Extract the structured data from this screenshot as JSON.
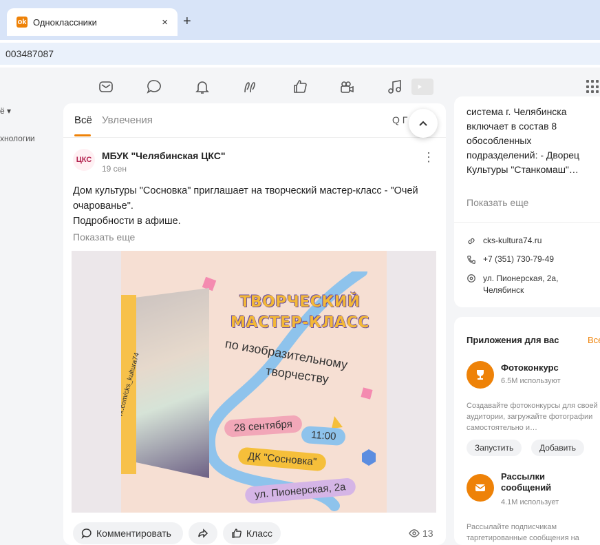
{
  "browser": {
    "tab_title": "Одноклассники",
    "close": "×",
    "new_tab": "+",
    "url": "003487087"
  },
  "left": {
    "item1": "ё ▾",
    "item2": "хнологии"
  },
  "feed": {
    "tab_all": "Всё",
    "tab_hobby": "Увлечения",
    "search": "Q Г"
  },
  "post": {
    "avatar_text": "ЦКС",
    "author": "МБУК \"Челябинская ЦКС\"",
    "date": "19 сен",
    "text_line1": "Дом культуры \"Сосновка\" приглашает на творческий мастер-класс - \"Очей очарованье\".",
    "text_line2": "Подробности в афише.",
    "show_more": "Показать еще",
    "comment": "Комментировать",
    "like": "Класс",
    "views": "13"
  },
  "poster": {
    "side_text": "vk.com/cks_kultura74",
    "title_line1": "ТВОРЧЕСКИЙ",
    "title_line2": "МАСТЕР-КЛАСС",
    "sub1": "по изобразительному",
    "sub2": "творчеству",
    "date": "28 сентября",
    "time": "11:00",
    "place": "ДК \"Сосновка\"",
    "address": "ул. Пионерская, 2а"
  },
  "about": {
    "text": "система г. Челябинска включает в состав 8 обособленных подразделений: - Дворец Культуры \"Станкомаш\"…",
    "show_more": "Показать еще",
    "site": "cks-kultura74.ru",
    "phone": "+7 (351) 730-79-49",
    "address": "ул. Пионерская, 2а, Челябинск"
  },
  "apps": {
    "title": "Приложения для вас",
    "all": "Все",
    "app1_name": "Фотоконкурс",
    "app1_users": "6.5M используют",
    "app1_desc": "Создавайте фотоконкурсы для своей аудитории, загружайте фотографии самостоятельно и…",
    "launch": "Запустить",
    "add": "Добавить",
    "app2_name": "Рассылки сообщений",
    "app2_users": "4.1M использует",
    "app2_desc": "Рассылайте подписчикам таргетированные сообщения на"
  },
  "colors": {
    "accent": "#ee8208",
    "browser_tabbar": "#d8e4f8"
  }
}
